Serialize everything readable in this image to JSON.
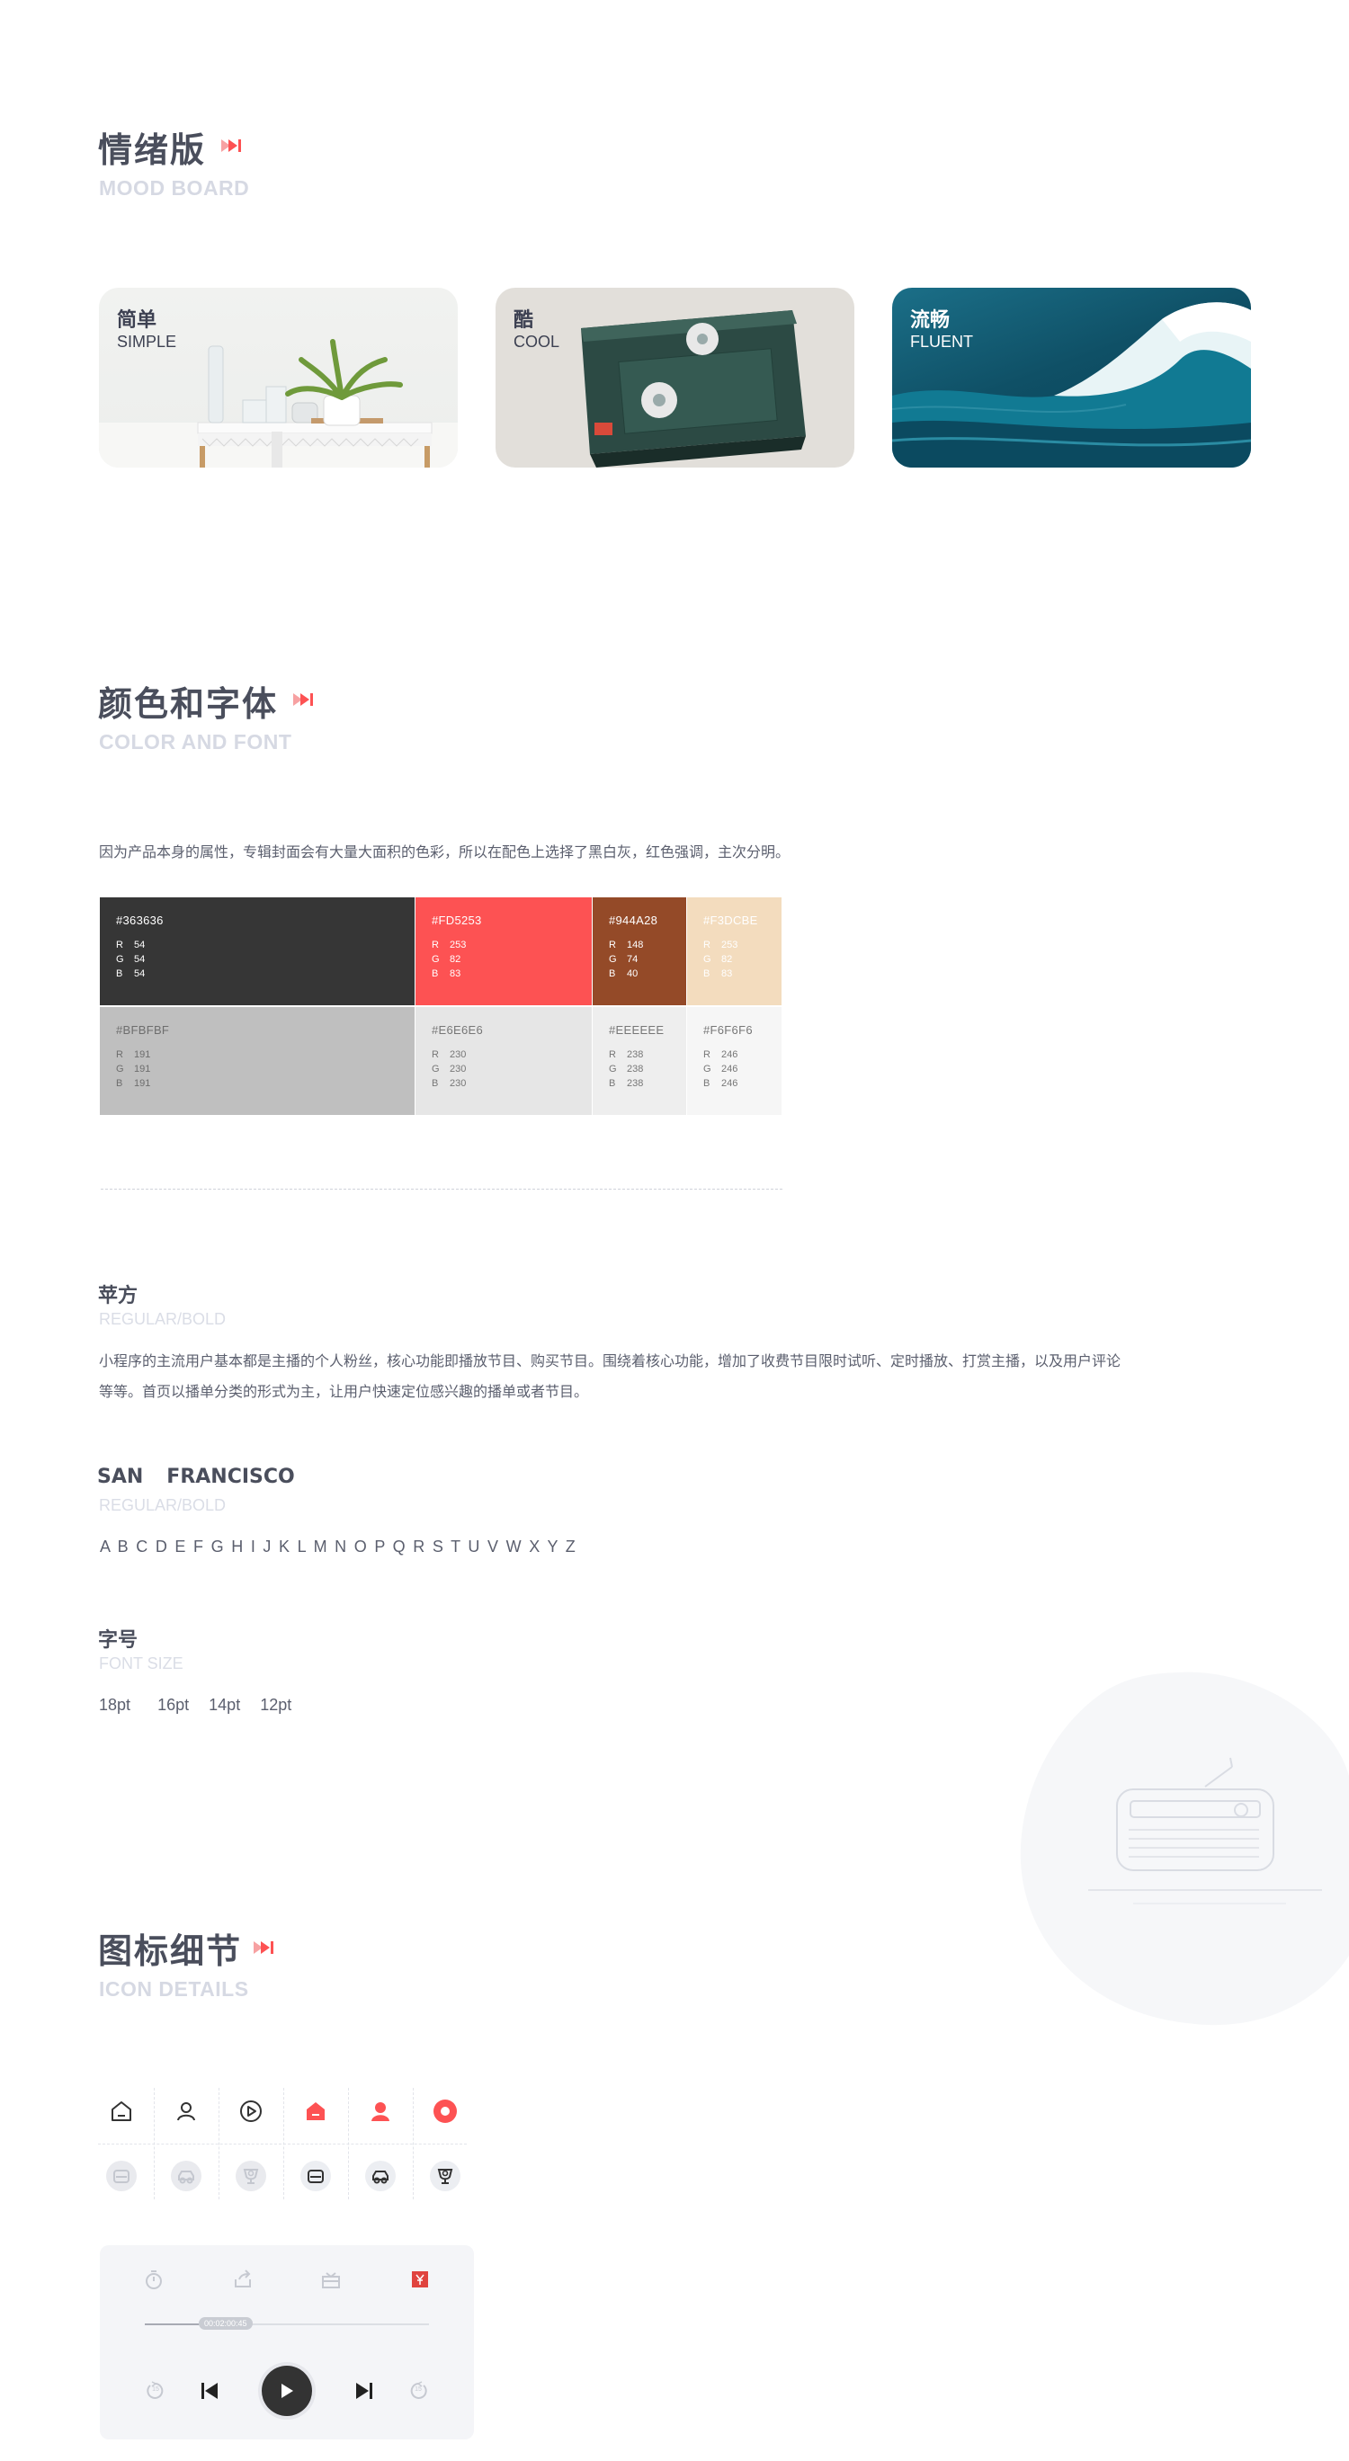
{
  "moodboard": {
    "title": "情绪版",
    "subtitle": "MOOD BOARD",
    "cards": [
      {
        "cn": "简单",
        "en": "SIMPLE"
      },
      {
        "cn": "酷",
        "en": "COOL"
      },
      {
        "cn": "流畅",
        "en": "FLUENT"
      }
    ]
  },
  "colorfont": {
    "title": "颜色和字体",
    "subtitle": "COLOR AND FONT",
    "description": "因为产品本身的属性，专辑封面会有大量大面积的色彩，所以在配色上选择了黑白灰，红色强调，主次分明。",
    "swatches": [
      {
        "hex": "#363636",
        "r": "54",
        "g": "54",
        "b": "54",
        "color": "#363636"
      },
      {
        "hex": "#FD5253",
        "r": "253",
        "g": "82",
        "b": "83",
        "color": "#FD5253"
      },
      {
        "hex": "#944A28",
        "r": "148",
        "g": "74",
        "b": "40",
        "color": "#944A28"
      },
      {
        "hex": "#F3DCBE",
        "r": "253",
        "g": "82",
        "b": "83",
        "color": "#F3DCBE"
      },
      {
        "hex": "#BFBFBF",
        "r": "191",
        "g": "191",
        "b": "191",
        "color": "#BFBFBF"
      },
      {
        "hex": "#E6E6E6",
        "r": "230",
        "g": "230",
        "b": "230",
        "color": "#E6E6E6"
      },
      {
        "hex": "#EEEEEE",
        "r": "238",
        "g": "238",
        "b": "238",
        "color": "#EEEEEE"
      },
      {
        "hex": "#F6F6F6",
        "r": "246",
        "g": "246",
        "b": "246",
        "color": "#F6F6F6"
      }
    ],
    "rgb_labels": {
      "r": "R",
      "g": "G",
      "b": "B"
    },
    "font1": {
      "name": "苹方",
      "weight": "REGULAR/BOLD",
      "desc1": "小程序的主流用户基本都是主播的个人粉丝，核心功能即播放节目、购买节目。围绕着核心功能，增加了收费节目限时试听、定时播放、打赏主播，以及用户评论",
      "desc2": "等等。首页以播单分类的形式为主，让用户快速定位感兴趣的播单或者节目。"
    },
    "font2": {
      "name_part1": "SAN",
      "name_part2": "FRANCISCO",
      "weight": "REGULAR/BOLD",
      "alphabet": "A B C D E F G H I J K L M N O P Q R S T U V W X Y Z"
    },
    "fontsize": {
      "title": "字号",
      "subtitle": "FONT SIZE",
      "sizes": [
        "18pt",
        "16pt",
        "14pt",
        "12pt"
      ]
    }
  },
  "icons": {
    "title": "图标细节",
    "subtitle": "ICON DETAILS",
    "grid_icons": [
      "home-outline-icon",
      "user-outline-icon",
      "play-circle-outline-icon",
      "home-filled-icon",
      "user-filled-icon",
      "play-circle-filled-icon",
      "radio-disabled-icon",
      "car-disabled-icon",
      "trophy-disabled-icon",
      "radio-active-icon",
      "car-active-icon",
      "trophy-active-icon"
    ],
    "player": {
      "time": "00:02:00:45",
      "skip_back_label": "15",
      "skip_forward_label": "15"
    }
  },
  "colors": {
    "accent": "#FD5253",
    "title": "#4a4e5c",
    "subtitle": "#d6d9e3"
  }
}
